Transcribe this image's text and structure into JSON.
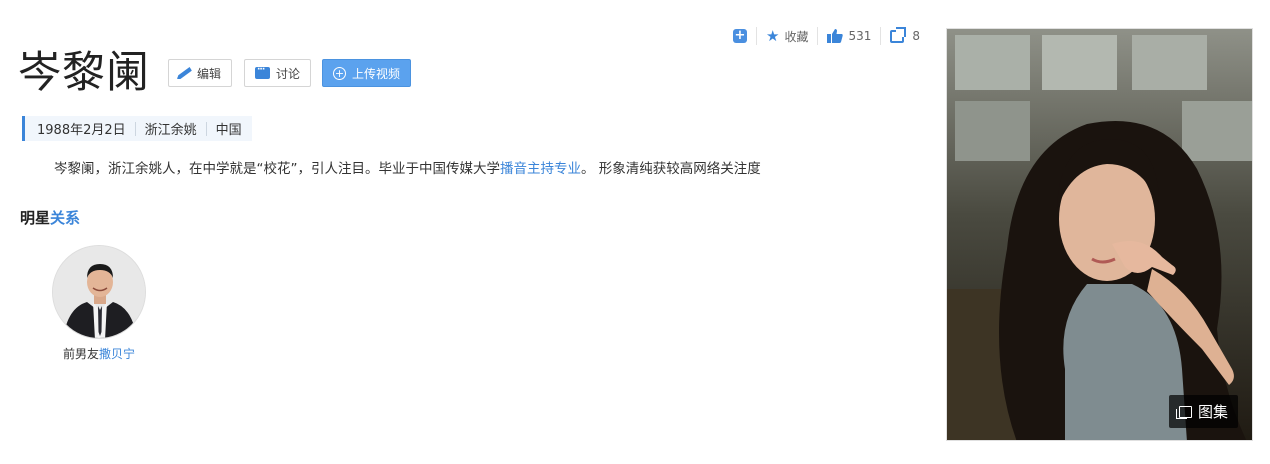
{
  "toolbar": {
    "add_icon": "plus-square-icon",
    "favorite_label": "收藏",
    "like_count": "531",
    "share_count": "8"
  },
  "header": {
    "title": "岑黎阑",
    "edit_label": "编辑",
    "discuss_label": "讨论",
    "upload_video_label": "上传视频"
  },
  "info": {
    "birth_date": "1988年2月2日",
    "birthplace": "浙江余姚",
    "country": "中国"
  },
  "description": {
    "text_before": "岑黎阑，浙江余姚人，在中学就是“校花”，引人注目。毕业于中国传媒大学",
    "link_text": "播音主持专业",
    "text_after": "。 形象清纯获较高网络关注度"
  },
  "relations": {
    "title_part1": "明星",
    "title_part2": "关系",
    "items": [
      {
        "relation": "前男友",
        "name": "撒贝宁"
      }
    ]
  },
  "gallery": {
    "label": "图集"
  },
  "colors": {
    "accent": "#3b85d9",
    "button_blue": "#5ba2ee"
  }
}
